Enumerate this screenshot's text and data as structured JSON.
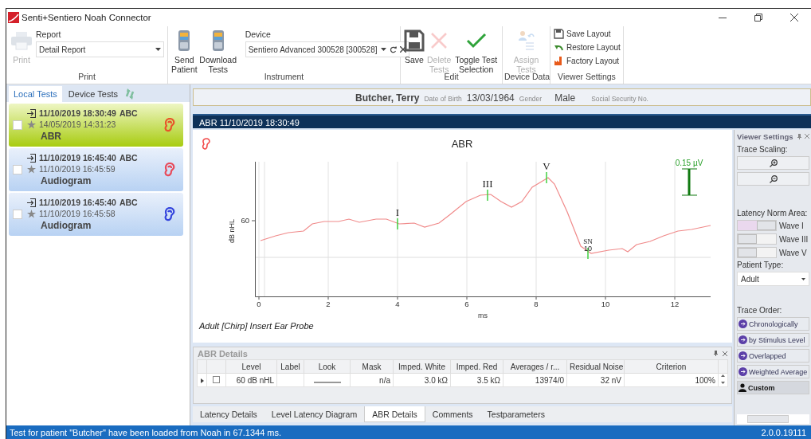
{
  "window": {
    "title": "Senti+Sentiero Noah Connector"
  },
  "ribbon": {
    "print": {
      "button": {
        "label": "Print",
        "disabled": true
      },
      "report_label": "Report",
      "report_value": "Detail Report",
      "group": "Print"
    },
    "instrument": {
      "buttons": [
        {
          "label": "Send Patient",
          "disabled": false
        },
        {
          "label": "Download Tests",
          "disabled": false
        }
      ],
      "device_label": "Device",
      "device_value": "Sentiero Advanced 300528 [300528]",
      "group": "Instrument"
    },
    "edit": {
      "buttons": [
        {
          "label": "Save",
          "disabled": false
        },
        {
          "label": "Delete Tests",
          "disabled": true
        },
        {
          "label": "Toggle Test Selection",
          "disabled": false
        }
      ],
      "group": "Edit"
    },
    "device_data": {
      "buttons": [
        {
          "label": "Assign Tests",
          "disabled": true
        }
      ],
      "group": "Device Data"
    },
    "viewer_settings": {
      "buttons": [
        {
          "label": "Save Layout"
        },
        {
          "label": "Restore Layout"
        },
        {
          "label": "Factory Layout"
        }
      ],
      "group": "Viewer Settings"
    }
  },
  "tests_panel": {
    "tabs": [
      {
        "label": "Local Tests",
        "selected": true
      },
      {
        "label": "Device Tests",
        "selected": false
      }
    ],
    "tests": [
      {
        "imported": "11/10/2019 18:30:49",
        "examiner": "ABC",
        "measured": "14/05/2019 14:31:23",
        "type": "ABR",
        "checked": false,
        "selected": true,
        "color": "#e8542a"
      },
      {
        "imported": "11/10/2019 16:45:40",
        "examiner": "ABC",
        "measured": "11/10/2019 16:45:59",
        "type": "Audiogram",
        "checked": false,
        "selected": false,
        "color": "#e84a5a"
      },
      {
        "imported": "11/10/2019 16:45:40",
        "examiner": "ABC",
        "measured": "11/10/2019 16:45:58",
        "type": "Audiogram",
        "checked": false,
        "selected": false,
        "color": "#3344dd"
      }
    ]
  },
  "patient": {
    "name": "Butcher, Terry",
    "dob_label": "Date of Birth",
    "dob": "13/03/1964",
    "gender_label": "Gender",
    "gender": "Male",
    "ssn_label": "Social Security No."
  },
  "test_header": "ABR 11/10/2019 18:30:49",
  "chart": {
    "title": "ABR",
    "y_label": "dB nHL",
    "y_tick": "60",
    "x_label": "ms",
    "x_ticks": [
      "0",
      "2",
      "4",
      "6",
      "8",
      "10",
      "12"
    ],
    "waves": [
      {
        "label": "I"
      },
      {
        "label": "III"
      },
      {
        "label": "V"
      },
      {
        "label": "SN"
      }
    ],
    "sn_value": "10",
    "scale": "0.15 µV",
    "caption": "Adult [Chirp] Insert Ear Probe"
  },
  "details": {
    "title": "ABR Details",
    "columns": [
      "Level",
      "Label",
      "Look",
      "Mask",
      "Imped. White",
      "Imped. Red",
      "Averages / r...",
      "Residual Noise",
      "Criterion"
    ],
    "row": {
      "checked": false,
      "level": "60 dB nHL",
      "mask": "n/a",
      "imped_white": "3.0 kΩ",
      "imped_red": "3.5 kΩ",
      "averages": "13974/0",
      "residual_noise": "32 nV",
      "criterion": "100%"
    }
  },
  "bottom_tabs": [
    {
      "label": "Latency Details",
      "selected": false
    },
    {
      "label": "Level Latency Diagram",
      "selected": false
    },
    {
      "label": "ABR Details",
      "selected": true
    },
    {
      "label": "Comments",
      "selected": false
    },
    {
      "label": "Testparameters",
      "selected": false
    }
  ],
  "viewer_settings": {
    "title": "Viewer Settings",
    "trace_scaling_label": "Trace Scaling:",
    "latency_label": "Latency Norm Area:",
    "waves": [
      {
        "label": "Wave I",
        "on": true
      },
      {
        "label": "Wave III",
        "on": false
      },
      {
        "label": "Wave V",
        "on": false
      }
    ],
    "patient_type_label": "Patient Type:",
    "patient_type": "Adult",
    "trace_order_label": "Trace Order:",
    "trace_order": [
      {
        "label": "Chronologically",
        "selected": false
      },
      {
        "label": "by Stimulus Level",
        "selected": false
      },
      {
        "label": "Overlapped",
        "selected": false
      },
      {
        "label": "Weighted Average",
        "selected": false
      },
      {
        "label": "Custom",
        "selected": true
      }
    ]
  },
  "status_bar": {
    "message": "Test for patient \"Butcher\" have been loaded from Noah in 67.1344 ms.",
    "version": "2.0.0.19111"
  }
}
